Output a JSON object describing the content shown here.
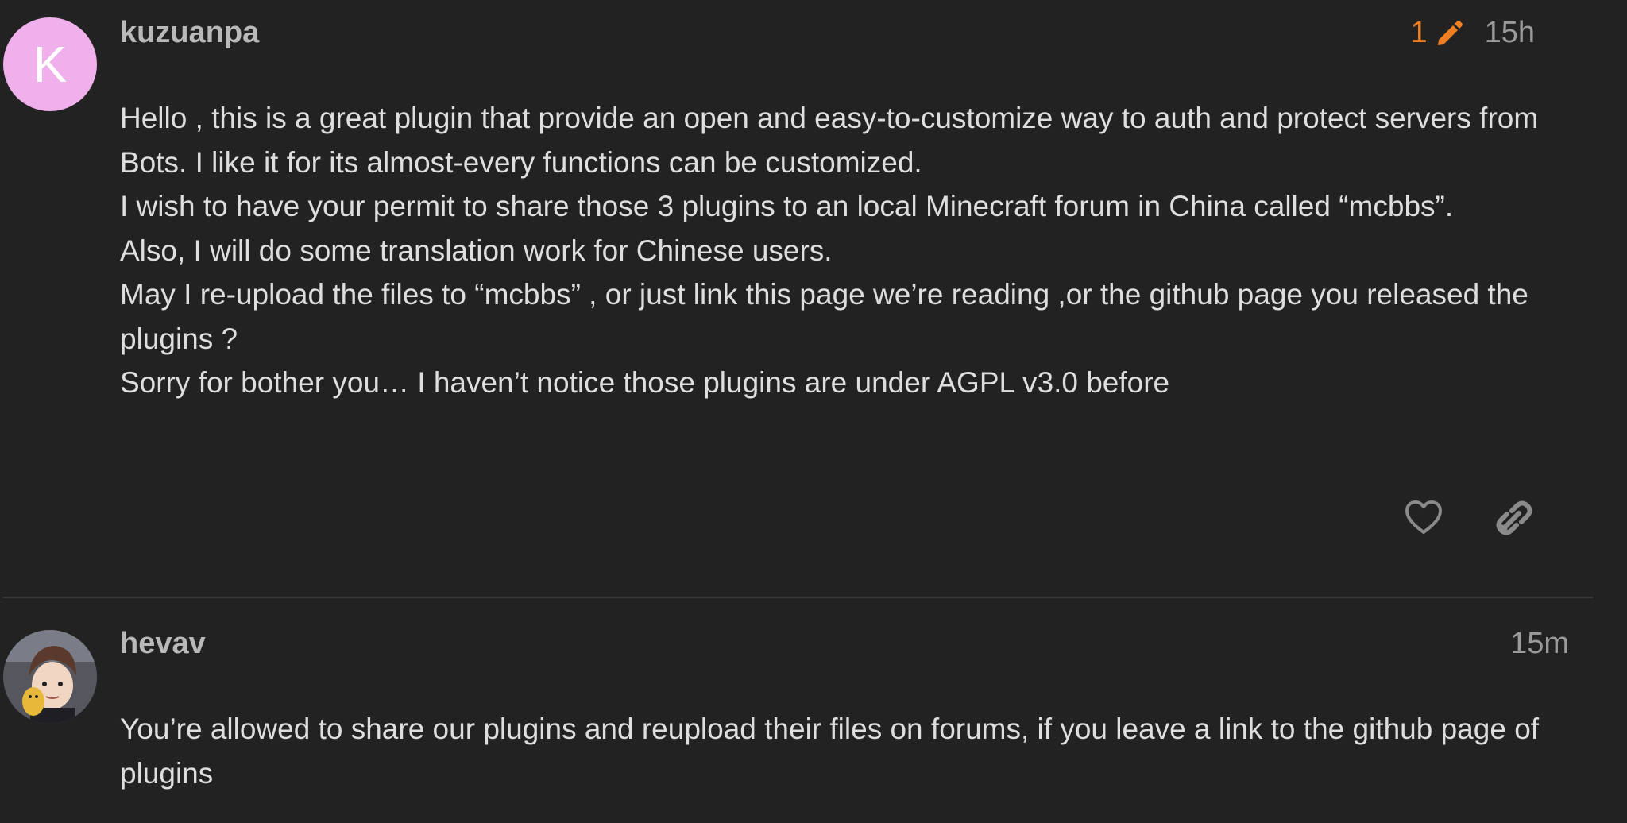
{
  "posts": [
    {
      "username": "kuzuanpa",
      "avatar_letter": "K",
      "edit_count": "1",
      "time": "15h",
      "lines": [
        "Hello , this is a great plugin that provide an open and easy-to-customize way to auth and protect servers from Bots. I like it for its almost-every functions can be customized.",
        "I wish to have your permit to share those 3 plugins to an local Minecraft forum in China called “mcbbs”.",
        "Also, I will do some translation work for Chinese users.",
        "May I re-upload the files to “mcbbs” , or just link this page we’re reading ,or the github page you released the plugins ?",
        "Sorry for bother you… I haven’t notice those plugins are under AGPL v3.0 before"
      ]
    },
    {
      "username": "hevav",
      "time": "15m",
      "lines": [
        "You’re allowed to share our plugins and reupload their files on forums, if you leave a link to the github page of plugins"
      ]
    }
  ],
  "icons": {
    "edit": "pencil-icon",
    "like": "heart-icon",
    "share": "link-icon"
  },
  "colors": {
    "background": "#222222",
    "accent": "#ef7f23",
    "avatar": "#f0b0ec"
  }
}
